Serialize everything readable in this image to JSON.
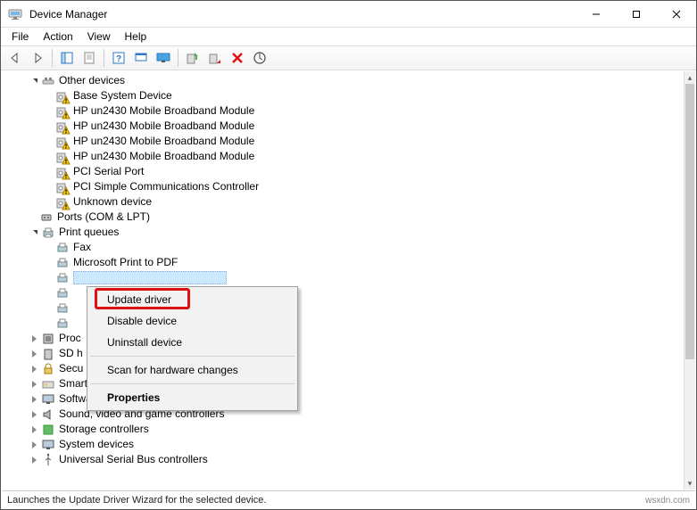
{
  "window": {
    "title": "Device Manager"
  },
  "menubar": [
    "File",
    "Action",
    "View",
    "Help"
  ],
  "toolbar_icons": [
    "back-arrow-icon",
    "forward-arrow-icon",
    "show-hidden-icon",
    "properties-icon",
    "help-icon",
    "refresh-icon",
    "monitor-icon",
    "update-driver-icon",
    "disable-icon",
    "uninstall-icon",
    "scan-icon"
  ],
  "tree": {
    "other_devices": {
      "label": "Other devices",
      "items": [
        "Base System Device",
        "HP un2430 Mobile Broadband Module",
        "HP un2430 Mobile Broadband Module",
        "HP un2430 Mobile Broadband Module",
        "HP un2430 Mobile Broadband Module",
        "PCI Serial Port",
        "PCI Simple Communications Controller",
        "Unknown device"
      ]
    },
    "ports": {
      "label": "Ports (COM & LPT)"
    },
    "print_queues": {
      "label": "Print queues",
      "items": [
        "Fax",
        "Microsoft Print to PDF",
        "",
        "",
        "",
        ""
      ]
    },
    "processors": {
      "label": "Proc"
    },
    "sd_host": {
      "label": "SD h"
    },
    "security": {
      "label": "Secu"
    },
    "smart_card": {
      "label": "Smart card readers"
    },
    "software": {
      "label": "Software devices"
    },
    "sound": {
      "label": "Sound, video and game controllers"
    },
    "storage": {
      "label": "Storage controllers"
    },
    "system": {
      "label": "System devices"
    },
    "usb": {
      "label": "Universal Serial Bus controllers"
    }
  },
  "context_menu": {
    "items": [
      "Update driver",
      "Disable device",
      "Uninstall device"
    ],
    "scan": "Scan for hardware changes",
    "properties": "Properties"
  },
  "statusbar": {
    "text": "Launches the Update Driver Wizard for the selected device.",
    "source": "wsxdn.com"
  }
}
